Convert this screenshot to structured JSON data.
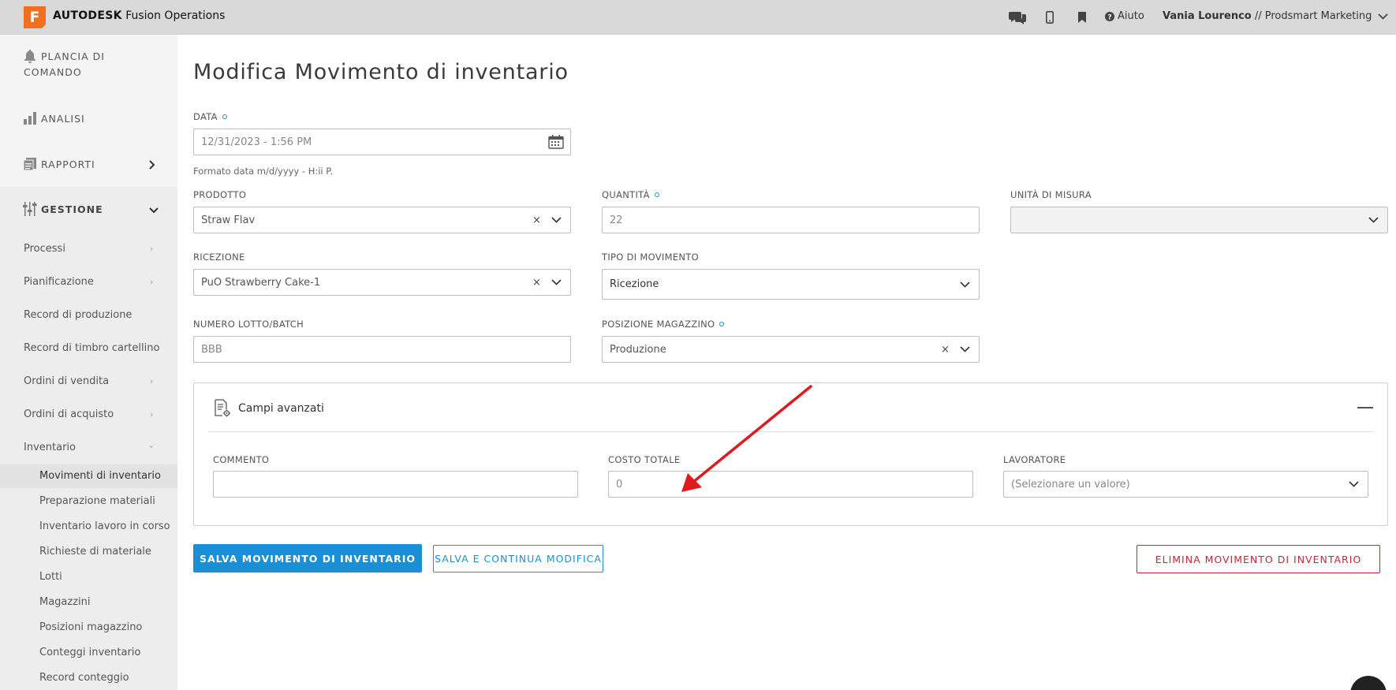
{
  "app": {
    "brand": "AUTODESK",
    "product": "Fusion Operations",
    "logo_letter": "F",
    "help_label": "Aiuto",
    "user_name": "Vania Lourenco",
    "user_org": "// Prodsmart Marketing"
  },
  "sidebar": {
    "dashboard": "PLANCIA DI",
    "dashboard_2": "COMANDO",
    "analytics": "ANALISI",
    "reports": "RAPPORTI",
    "management": "GESTIONE",
    "sub_items": [
      "Processi",
      "Pianificazione",
      "Record di produzione",
      "Record di timbro cartellino",
      "Ordini di vendita",
      "Ordini di acquisto",
      "Inventario"
    ],
    "inventory_items": [
      "Movimenti di inventario",
      "Preparazione materiali",
      "Inventario lavoro in corso",
      "Richieste di materiale",
      "Lotti",
      "Magazzini",
      "Posizioni magazzino",
      "Conteggi inventario",
      "Record conteggio"
    ]
  },
  "page": {
    "title": "Modifica Movimento di inventario"
  },
  "form": {
    "date_label": "DATA",
    "date_value": "12/31/2023 - 1:56 PM",
    "date_hint": "Formato data m/d/yyyy - H:ii P.",
    "product_label": "PRODOTTO",
    "product_value": "Straw Flav",
    "quantity_label": "QUANTITÀ",
    "quantity_value": "22",
    "unit_label": "UNITÀ DI MISURA",
    "unit_value": "",
    "receipt_label": "RICEZIONE",
    "receipt_value": "PuO Strawberry Cake-1",
    "movement_type_label": "TIPO DI MOVIMENTO",
    "movement_type_value": "Ricezione",
    "lot_label": "NUMERO LOTTO/BATCH",
    "lot_placeholder": "BBB",
    "warehouse_label": "POSIZIONE MAGAZZINO",
    "warehouse_value": "Produzione"
  },
  "advanced": {
    "title": "Campi avanzati",
    "comment_label": "COMMENTO",
    "comment_value": "",
    "total_cost_label": "COSTO TOTALE",
    "total_cost_placeholder": "0",
    "worker_label": "LAVORATORE",
    "worker_placeholder": "(Selezionare un valore)"
  },
  "actions": {
    "save": "SALVA MOVIMENTO DI INVENTARIO",
    "save_continue": "SALVA E CONTINUA MODIFICA",
    "delete": "ELIMINA MOVIMENTO DI INVENTARIO"
  },
  "colors": {
    "accent": "#1a8fd6",
    "danger": "#d0243a",
    "brand_orange": "#f2701d",
    "annotation_arrow": "#e0191f"
  },
  "icons": {
    "topbar": [
      "chat-icon",
      "mobile-icon",
      "bookmark-icon",
      "help-circle-icon",
      "chevron-down-icon"
    ],
    "sidebar": [
      "bell-icon",
      "bar-chart-icon",
      "report-icon",
      "sliders-icon"
    ]
  }
}
